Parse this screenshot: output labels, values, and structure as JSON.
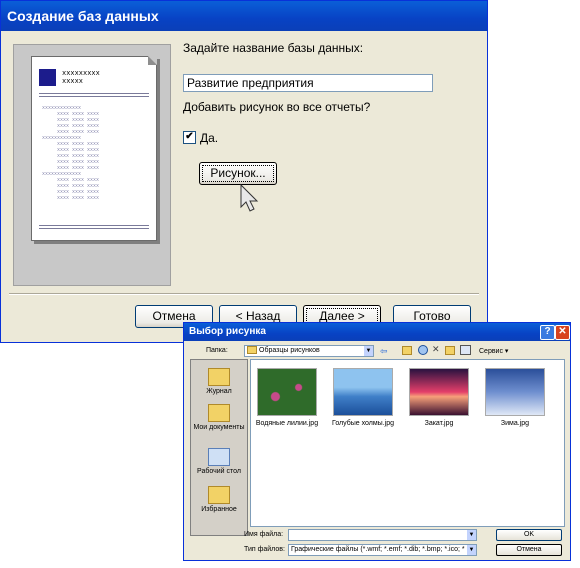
{
  "wizard": {
    "title": "Создание баз данных",
    "prompt_name": "Задайте название базы данных:",
    "name_value": "Развитие предприятия",
    "prompt_picture": "Добавить рисунок во все отчеты?",
    "checkbox_label": "Да.",
    "checkbox_mark": "✔",
    "picture_button": "Рисунок...",
    "buttons": {
      "cancel": "Отмена",
      "back": "< Назад",
      "next": "Далее >",
      "finish": "Готово"
    },
    "preview": {
      "header_line1": "xxxxxxxxx",
      "header_line2": "xxxxx"
    }
  },
  "dialog": {
    "title": "Выбор рисунка",
    "help": "?",
    "close": "✕",
    "folder_label": "Папка:",
    "folder_value": "Образцы рисунков",
    "tools_label": "Сервис",
    "toolbar_icons": [
      "back-arrow-icon",
      "up-folder-icon",
      "search-web-icon",
      "delete-icon",
      "new-folder-icon",
      "views-icon"
    ],
    "places": [
      {
        "label": "Журнал",
        "icon": "history-icon"
      },
      {
        "label": "Мои документы",
        "icon": "my-documents-icon"
      },
      {
        "label": "Рабочий стол",
        "icon": "desktop-icon"
      },
      {
        "label": "Избранное",
        "icon": "favorites-icon"
      }
    ],
    "files": [
      {
        "name": "Водяные лилии.jpg",
        "colors": [
          "#2f6b2a",
          "#c64a8a"
        ]
      },
      {
        "name": "Голубые холмы.jpg",
        "colors": [
          "#8ec3ef",
          "#1c4f9a"
        ]
      },
      {
        "name": "Закат.jpg",
        "colors": [
          "#e43f6a",
          "#2a1240"
        ]
      },
      {
        "name": "Зима.jpg",
        "colors": [
          "#2b4f9a",
          "#dfe8f6"
        ]
      }
    ],
    "filename_label": "Имя файла:",
    "filename_value": "",
    "filetype_label": "Тип файлов:",
    "filetype_value": "Графические файлы (*.wmf; *.emf; *.dib; *.bmp; *.ico; *",
    "ok": "OK",
    "cancel": "Отмена"
  }
}
